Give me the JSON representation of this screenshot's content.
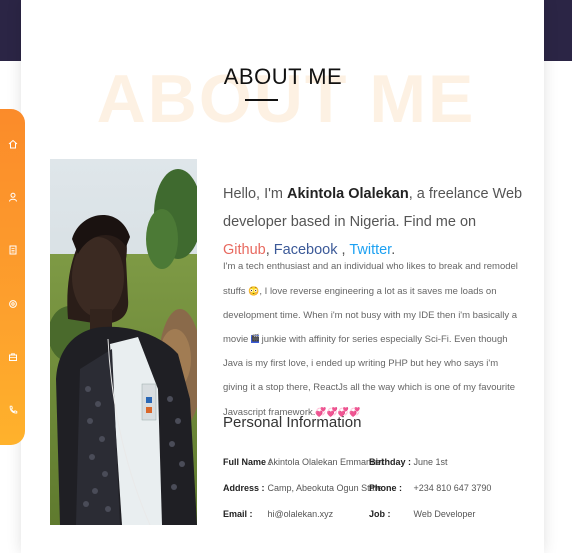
{
  "section": {
    "watermark": "ABOUT ME",
    "title": "ABOUT ME"
  },
  "sidebar": {
    "items": [
      {
        "icon": "home-icon"
      },
      {
        "icon": "user-icon"
      },
      {
        "icon": "resume-icon"
      },
      {
        "icon": "settings-icon"
      },
      {
        "icon": "briefcase-icon"
      },
      {
        "icon": "phone-icon"
      }
    ]
  },
  "intro": {
    "greeting": "Hello, I'm ",
    "name": "Akintola Olalekan",
    "tagline": ", a freelance Web developer based in Nigeria. Find me on ",
    "github": "Github",
    "comma1": ", ",
    "facebook": "Facebook",
    "comma2": " , ",
    "twitter": "Twitter",
    "period": "."
  },
  "bio": {
    "part1": "I'm a tech enthusiast and an individual who likes to break and remodel stuffs ",
    "emoji1": "😳",
    "part2": ", I love reverse engineering a lot as it saves me loads on development time. When i'm not busy with my IDE then i'm basically a movie ",
    "emoji2": "🎬",
    "part3": " junkie with affinity for series especially Sci-Fi. Even though Java is my first love, i ended up writing PHP but hey who says i'm giving it a stop there, ReactJs all the way which is one of my favourite Javascript framework.",
    "emoji3": "💞💞💞💞"
  },
  "personal": {
    "heading": "Personal Information",
    "fields": [
      {
        "label": "Full Name :",
        "value": "Akintola Olalekan Emmanuel"
      },
      {
        "label": "Birthday :",
        "value": "June 1st"
      },
      {
        "label": "Address :",
        "value": "Camp, Abeokuta Ogun State"
      },
      {
        "label": "Phone :",
        "value": "+234 810 647 3790"
      },
      {
        "label": "Email :",
        "value": "hi@olalekan.xyz"
      },
      {
        "label": "Job :",
        "value": "Web Developer"
      }
    ]
  },
  "colors": {
    "accent": "#fb8b2a",
    "header_band": "#2b2545",
    "github": "#e8695f",
    "facebook": "#3b5998",
    "twitter": "#1da1f2"
  }
}
